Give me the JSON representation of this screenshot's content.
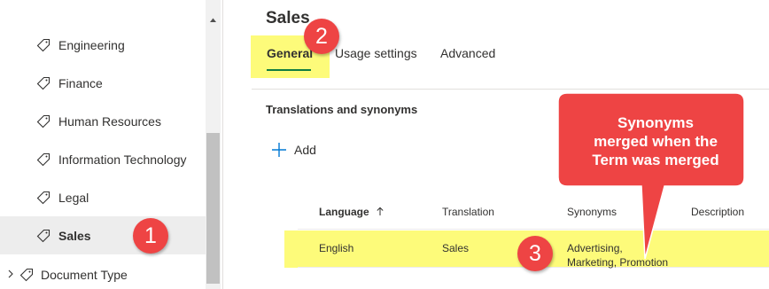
{
  "tree": {
    "items": [
      {
        "label": "Engineering"
      },
      {
        "label": "Finance"
      },
      {
        "label": "Human Resources"
      },
      {
        "label": "Information Technology"
      },
      {
        "label": "Legal"
      },
      {
        "label": "Sales",
        "selected": true
      }
    ],
    "parent_item": {
      "label": "Document Type"
    }
  },
  "page": {
    "title": "Sales",
    "tabs": [
      {
        "label": "General",
        "active": true
      },
      {
        "label": "Usage settings"
      },
      {
        "label": "Advanced"
      }
    ]
  },
  "translations": {
    "section_title": "Translations and synonyms",
    "add_label": "Add",
    "columns": {
      "language": "Language",
      "translation": "Translation",
      "synonyms": "Synonyms",
      "description": "Description"
    },
    "rows": [
      {
        "language": "English",
        "translation": "Sales",
        "synonyms_line1": "Advertising,",
        "synonyms_line2": "Marketing, Promotion",
        "description": ""
      }
    ]
  },
  "annotations": {
    "badge1": "1",
    "badge2": "2",
    "badge3": "3",
    "callout_line1": "Synonyms",
    "callout_line2": "merged when the",
    "callout_line3": "Term was merged",
    "highlight_color": "#fdfb7a",
    "badge_color": "#ee4444"
  },
  "colors": {
    "accent": "#107c41",
    "selected_bg": "#ededed"
  },
  "icons": {
    "tree_item": "tag-icon",
    "expander": "chevron-right-icon",
    "add": "plus-icon",
    "sort": "arrow-up-icon",
    "scroll": "scroll-up-arrow-icon"
  }
}
